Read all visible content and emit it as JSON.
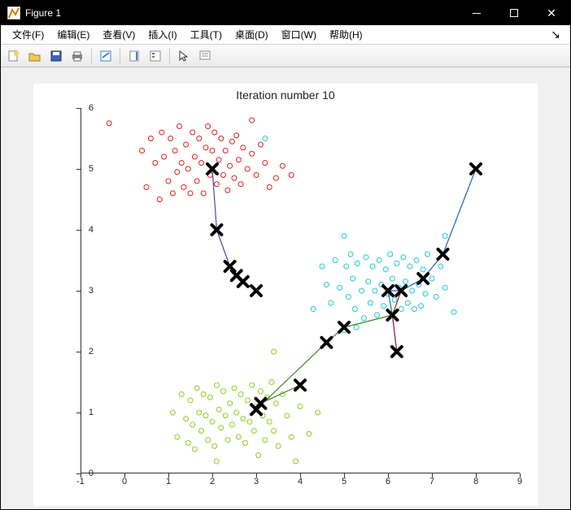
{
  "window": {
    "title": "Figure 1"
  },
  "menu": {
    "file": "文件(F)",
    "edit": "编辑(E)",
    "view": "查看(V)",
    "insert": "插入(I)",
    "tools": "工具(T)",
    "desktop": "桌面(D)",
    "window": "窗口(W)",
    "help": "帮助(H)"
  },
  "toolbar": {
    "new": "new-figure",
    "open": "open",
    "save": "save",
    "print": "print",
    "link": "link",
    "colorbar": "colorbar",
    "legend": "legend",
    "pointer": "pointer",
    "datacursor": "datacursor"
  },
  "chart_data": {
    "type": "scatter",
    "title": "Iteration number 10",
    "xlabel": "",
    "ylabel": "",
    "xlim": [
      -1,
      9
    ],
    "ylim": [
      0,
      6
    ],
    "xticks": [
      -1,
      0,
      1,
      2,
      3,
      4,
      5,
      6,
      7,
      8,
      9
    ],
    "yticks": [
      0,
      1,
      2,
      3,
      4,
      5,
      6
    ],
    "series": [
      {
        "name": "cluster-red",
        "color": "#e02020",
        "marker": "o",
        "points": [
          [
            -0.35,
            5.75
          ],
          [
            0.4,
            5.3
          ],
          [
            0.5,
            4.7
          ],
          [
            0.6,
            5.5
          ],
          [
            0.7,
            5.1
          ],
          [
            0.8,
            4.5
          ],
          [
            0.85,
            5.6
          ],
          [
            0.9,
            5.2
          ],
          [
            1.0,
            4.8
          ],
          [
            1.05,
            5.5
          ],
          [
            1.1,
            4.6
          ],
          [
            1.15,
            5.3
          ],
          [
            1.2,
            4.95
          ],
          [
            1.25,
            5.7
          ],
          [
            1.3,
            5.1
          ],
          [
            1.35,
            4.7
          ],
          [
            1.4,
            5.4
          ],
          [
            1.45,
            5.0
          ],
          [
            1.5,
            4.6
          ],
          [
            1.55,
            5.6
          ],
          [
            1.6,
            5.2
          ],
          [
            1.65,
            4.8
          ],
          [
            1.7,
            5.5
          ],
          [
            1.75,
            5.1
          ],
          [
            1.8,
            4.6
          ],
          [
            1.85,
            5.35
          ],
          [
            1.9,
            5.7
          ],
          [
            1.95,
            4.9
          ],
          [
            2.0,
            5.3
          ],
          [
            2.05,
            5.6
          ],
          [
            2.1,
            4.75
          ],
          [
            2.15,
            5.15
          ],
          [
            2.2,
            5.5
          ],
          [
            2.25,
            4.9
          ],
          [
            2.3,
            5.3
          ],
          [
            2.35,
            4.65
          ],
          [
            2.4,
            5.05
          ],
          [
            2.45,
            5.45
          ],
          [
            2.5,
            4.85
          ],
          [
            2.55,
            5.55
          ],
          [
            2.6,
            5.15
          ],
          [
            2.65,
            4.75
          ],
          [
            2.7,
            5.35
          ],
          [
            2.8,
            5.0
          ],
          [
            2.9,
            5.25
          ],
          [
            3.0,
            4.9
          ],
          [
            3.1,
            5.4
          ],
          [
            3.2,
            5.1
          ],
          [
            3.3,
            4.7
          ],
          [
            3.45,
            4.85
          ],
          [
            3.6,
            5.05
          ],
          [
            3.8,
            4.9
          ],
          [
            2.9,
            5.8
          ]
        ]
      },
      {
        "name": "cluster-cyan",
        "color": "#20c8d8",
        "marker": "o",
        "points": [
          [
            3.2,
            5.5
          ],
          [
            4.3,
            2.7
          ],
          [
            4.5,
            3.4
          ],
          [
            4.6,
            3.1
          ],
          [
            4.7,
            2.8
          ],
          [
            4.8,
            3.5
          ],
          [
            4.9,
            3.05
          ],
          [
            5.0,
            2.35
          ],
          [
            5.05,
            3.4
          ],
          [
            5.1,
            2.9
          ],
          [
            5.15,
            3.6
          ],
          [
            5.2,
            3.2
          ],
          [
            5.25,
            2.7
          ],
          [
            5.28,
            2.4
          ],
          [
            5.3,
            3.45
          ],
          [
            5.4,
            3.0
          ],
          [
            5.45,
            2.55
          ],
          [
            5.5,
            3.55
          ],
          [
            5.55,
            3.15
          ],
          [
            5.6,
            2.8
          ],
          [
            5.65,
            3.4
          ],
          [
            5.7,
            3.0
          ],
          [
            5.75,
            2.6
          ],
          [
            5.8,
            3.5
          ],
          [
            5.85,
            3.1
          ],
          [
            5.9,
            2.75
          ],
          [
            5.95,
            3.35
          ],
          [
            6.0,
            2.95
          ],
          [
            6.05,
            3.6
          ],
          [
            6.1,
            3.2
          ],
          [
            6.15,
            2.85
          ],
          [
            6.2,
            3.45
          ],
          [
            6.25,
            3.05
          ],
          [
            6.3,
            2.7
          ],
          [
            6.35,
            3.55
          ],
          [
            6.4,
            3.15
          ],
          [
            6.45,
            2.8
          ],
          [
            6.5,
            3.4
          ],
          [
            6.55,
            3.0
          ],
          [
            6.6,
            2.7
          ],
          [
            6.65,
            3.5
          ],
          [
            6.7,
            3.1
          ],
          [
            6.75,
            2.75
          ],
          [
            6.8,
            3.35
          ],
          [
            6.85,
            2.95
          ],
          [
            6.9,
            3.6
          ],
          [
            7.0,
            3.2
          ],
          [
            7.1,
            2.9
          ],
          [
            7.2,
            3.4
          ],
          [
            7.3,
            3.05
          ],
          [
            7.5,
            2.65
          ],
          [
            7.3,
            3.9
          ],
          [
            5.0,
            3.9
          ]
        ]
      },
      {
        "name": "cluster-green",
        "color": "#8ad020",
        "marker": "o",
        "points": [
          [
            1.1,
            1.0
          ],
          [
            1.2,
            0.6
          ],
          [
            1.3,
            1.3
          ],
          [
            1.4,
            0.9
          ],
          [
            1.45,
            0.5
          ],
          [
            1.5,
            1.2
          ],
          [
            1.55,
            0.8
          ],
          [
            1.6,
            0.4
          ],
          [
            1.65,
            1.4
          ],
          [
            1.7,
            1.0
          ],
          [
            1.75,
            0.7
          ],
          [
            1.8,
            1.3
          ],
          [
            1.85,
            0.95
          ],
          [
            1.9,
            0.55
          ],
          [
            1.95,
            1.25
          ],
          [
            2.0,
            0.85
          ],
          [
            2.05,
            0.45
          ],
          [
            2.1,
            1.45
          ],
          [
            2.15,
            1.05
          ],
          [
            2.2,
            0.75
          ],
          [
            2.25,
            1.35
          ],
          [
            2.3,
            0.95
          ],
          [
            2.35,
            0.55
          ],
          [
            2.4,
            1.15
          ],
          [
            2.45,
            0.8
          ],
          [
            2.5,
            1.4
          ],
          [
            2.55,
            1.0
          ],
          [
            2.6,
            0.6
          ],
          [
            2.65,
            1.3
          ],
          [
            2.7,
            0.9
          ],
          [
            2.75,
            0.5
          ],
          [
            2.8,
            1.2
          ],
          [
            2.85,
            0.85
          ],
          [
            2.9,
            1.45
          ],
          [
            2.95,
            0.7
          ],
          [
            3.0,
            1.1
          ],
          [
            3.05,
            0.3
          ],
          [
            3.1,
            1.35
          ],
          [
            3.15,
            0.95
          ],
          [
            3.2,
            0.55
          ],
          [
            3.25,
            1.25
          ],
          [
            3.3,
            0.85
          ],
          [
            3.35,
            1.5
          ],
          [
            3.4,
            0.7
          ],
          [
            3.45,
            1.15
          ],
          [
            3.5,
            0.45
          ],
          [
            3.6,
            1.3
          ],
          [
            3.7,
            0.95
          ],
          [
            3.8,
            0.6
          ],
          [
            3.9,
            0.2
          ],
          [
            4.0,
            1.1
          ],
          [
            4.2,
            0.65
          ],
          [
            4.4,
            1.0
          ],
          [
            3.4,
            2.0
          ],
          [
            2.1,
            0.2
          ]
        ]
      },
      {
        "name": "centroid-path-1",
        "color": "#6040a0",
        "type": "line",
        "points": [
          [
            2.0,
            5.0
          ],
          [
            2.1,
            4.0
          ],
          [
            2.4,
            3.4
          ],
          [
            2.55,
            3.25
          ],
          [
            2.7,
            3.15
          ],
          [
            3.0,
            3.0
          ]
        ]
      },
      {
        "name": "centroid-path-2",
        "color": "#2060c0",
        "type": "line",
        "points": [
          [
            8.0,
            5.0
          ],
          [
            7.25,
            3.6
          ],
          [
            6.8,
            3.2
          ],
          [
            6.3,
            3.0
          ],
          [
            6.0,
            3.0
          ],
          [
            6.1,
            2.6
          ],
          [
            6.2,
            2.0
          ]
        ]
      },
      {
        "name": "centroid-path-3",
        "color": "#408020",
        "type": "line",
        "points": [
          [
            4.0,
            1.45
          ],
          [
            3.1,
            1.15
          ],
          [
            3.0,
            1.05
          ],
          [
            4.6,
            2.15
          ],
          [
            5.0,
            2.4
          ],
          [
            6.1,
            2.6
          ]
        ]
      },
      {
        "name": "centroid-path-extra",
        "color": "#903030",
        "type": "line",
        "points": [
          [
            6.3,
            3.0
          ],
          [
            6.1,
            2.6
          ],
          [
            6.2,
            2.0
          ]
        ]
      },
      {
        "name": "centroids",
        "color": "#000000",
        "marker": "x-bold",
        "points": [
          [
            2.0,
            5.0
          ],
          [
            2.1,
            4.0
          ],
          [
            2.4,
            3.4
          ],
          [
            2.55,
            3.25
          ],
          [
            2.7,
            3.15
          ],
          [
            3.0,
            3.0
          ],
          [
            8.0,
            5.0
          ],
          [
            7.25,
            3.6
          ],
          [
            6.8,
            3.2
          ],
          [
            6.3,
            3.0
          ],
          [
            6.0,
            3.0
          ],
          [
            6.1,
            2.6
          ],
          [
            6.2,
            2.0
          ],
          [
            4.0,
            1.45
          ],
          [
            3.1,
            1.15
          ],
          [
            3.0,
            1.05
          ],
          [
            4.6,
            2.15
          ],
          [
            5.0,
            2.4
          ]
        ]
      }
    ]
  }
}
